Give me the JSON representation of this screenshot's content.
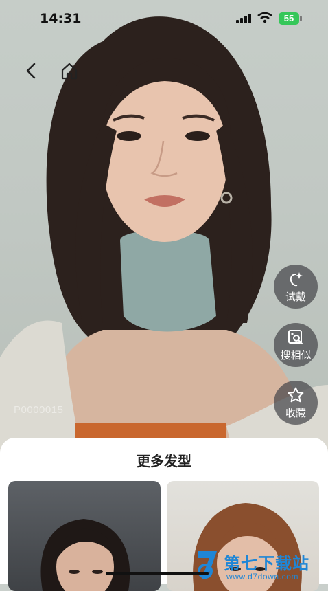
{
  "status_bar": {
    "time": "14:31",
    "battery": "55"
  },
  "nav": {
    "back_icon": "chevron-left-icon",
    "home_icon": "home-icon"
  },
  "photo": {
    "id_watermark": "P0000015"
  },
  "actions": [
    {
      "label": "试戴",
      "icon": "sparkle-face-icon"
    },
    {
      "label": "搜相似",
      "icon": "image-search-icon"
    },
    {
      "label": "收藏",
      "icon": "star-icon"
    }
  ],
  "more_styles": {
    "title": "更多发型"
  },
  "site_watermark": {
    "name": "第七下载站",
    "url": "www.d7down.com"
  },
  "colors": {
    "battery_green": "#35c759",
    "sheet_bg": "#ffffff",
    "action_bg": "#46464b",
    "brand_blue": "#1f86d6"
  }
}
